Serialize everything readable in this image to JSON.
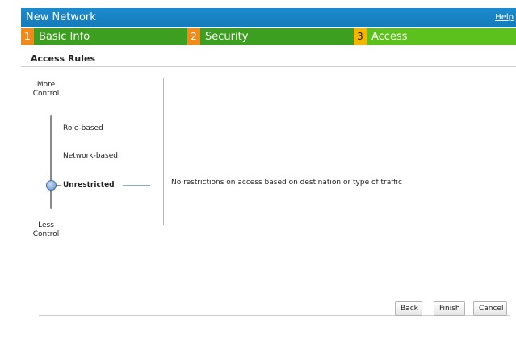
{
  "titlebar": {
    "title": "New Network",
    "help": "Help"
  },
  "steps": [
    {
      "num": "1",
      "label": "Basic Info"
    },
    {
      "num": "2",
      "label": "Security"
    },
    {
      "num": "3",
      "label": "Access"
    }
  ],
  "section": {
    "title": "Access Rules"
  },
  "slider": {
    "top_label": "More\nControl",
    "bottom_label": "Less\nControl",
    "options": [
      "Role-based",
      "Network-based",
      "Unrestricted"
    ],
    "selected": "Unrestricted"
  },
  "description": "No restrictions on access based on destination or type of traffic",
  "buttons": {
    "back": "Back",
    "finish": "Finish",
    "cancel": "Cancel"
  }
}
